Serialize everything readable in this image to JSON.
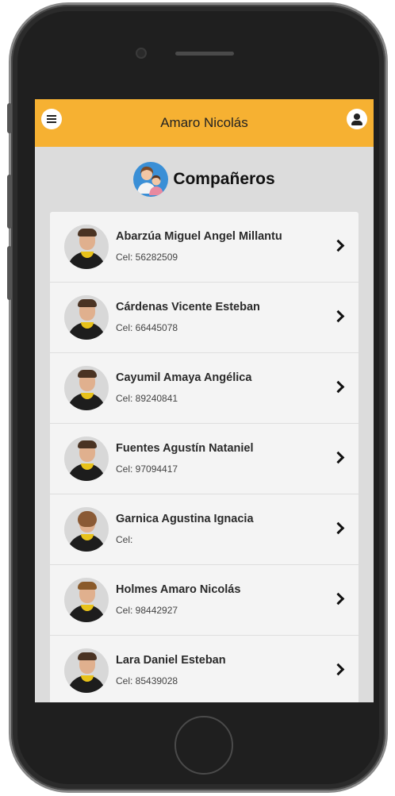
{
  "header": {
    "title": "Amaro Nicolás",
    "menu_icon": "menu-icon",
    "user_icon": "user-icon",
    "color": "#f6b132"
  },
  "section": {
    "title": "Compañeros",
    "icon": "classmates-icon"
  },
  "students": [
    {
      "name": "Abarzúa Miguel Angel Millantu",
      "phone": "Cel: 56282509"
    },
    {
      "name": "Cárdenas Vicente Esteban",
      "phone": "Cel: 66445078"
    },
    {
      "name": "Cayumil Amaya Angélica",
      "phone": "Cel: 89240841"
    },
    {
      "name": "Fuentes Agustín Nataniel",
      "phone": "Cel: 97094417"
    },
    {
      "name": "Garnica Agustina Ignacia",
      "phone": "Cel:"
    },
    {
      "name": "Holmes Amaro Nicolás",
      "phone": "Cel: 98442927"
    },
    {
      "name": "Lara Daniel Esteban",
      "phone": "Cel: 85439028"
    }
  ]
}
